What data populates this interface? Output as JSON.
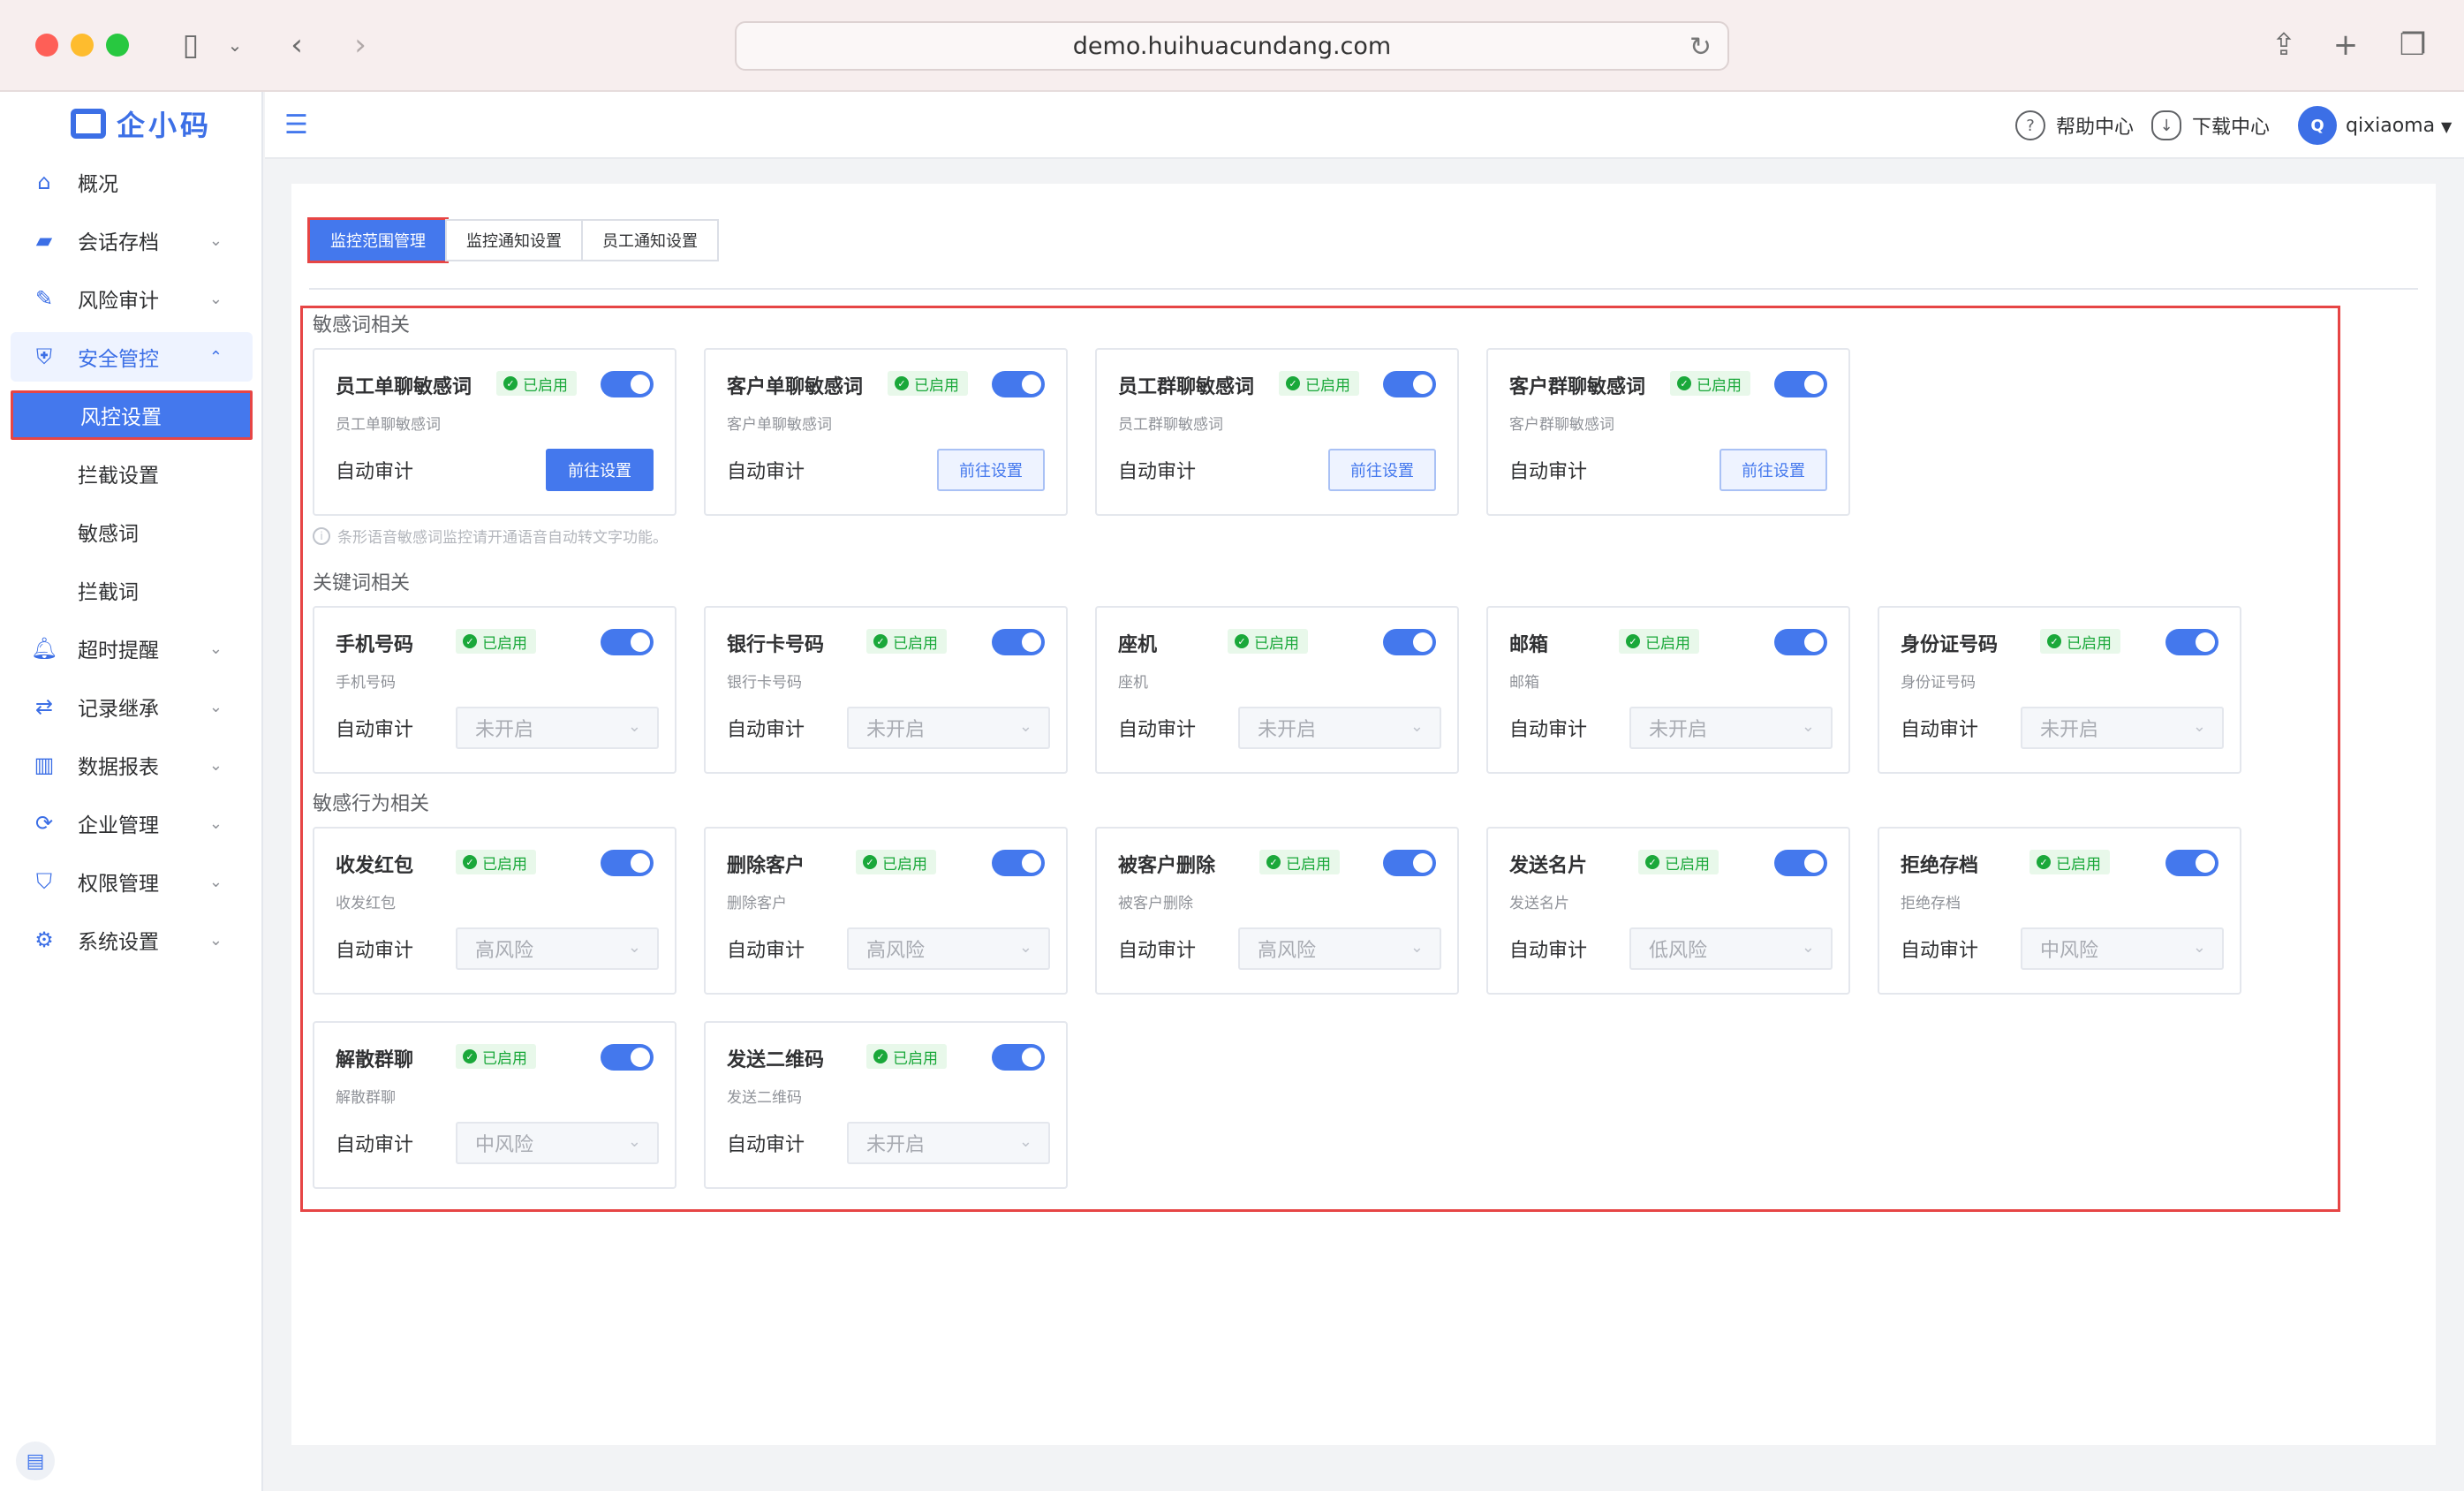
{
  "browser": {
    "url": "demo.huihuacundang.com"
  },
  "sidebar": {
    "logo": "企小码",
    "items": [
      {
        "label": "概况",
        "icon": "home-icon"
      },
      {
        "label": "会话存档",
        "icon": "folder-icon"
      },
      {
        "label": "风险审计",
        "icon": "edit-icon"
      },
      {
        "label": "安全管控",
        "icon": "shield-icon"
      },
      {
        "label": "超时提醒",
        "icon": "bell-icon"
      },
      {
        "label": "记录继承",
        "icon": "transfer-icon"
      },
      {
        "label": "数据报表",
        "icon": "chart-icon"
      },
      {
        "label": "企业管理",
        "icon": "sync-icon"
      },
      {
        "label": "权限管理",
        "icon": "lock-shield-icon"
      },
      {
        "label": "系统设置",
        "icon": "gear-icon"
      }
    ],
    "subitems": [
      "风控设置",
      "拦截设置",
      "敏感词",
      "拦截词"
    ]
  },
  "header": {
    "help": "帮助中心",
    "download": "下载中心",
    "avatar_letter": "Q",
    "username": "qixiaoma"
  },
  "tabs": [
    "监控范围管理",
    "监控通知设置",
    "员工通知设置"
  ],
  "sections": {
    "sensitive": "敏感词相关",
    "keyword": "关键词相关",
    "behavior": "敏感行为相关"
  },
  "hint": "条形语音敏感词监控请开通语音自动转文字功能。",
  "common": {
    "enabled": "已启用",
    "auto_audit": "自动审计",
    "goto": "前往设置"
  },
  "sensitive_cards": [
    {
      "title": "员工单聊敏感词",
      "sub": "员工单聊敏感词"
    },
    {
      "title": "客户单聊敏感词",
      "sub": "客户单聊敏感词"
    },
    {
      "title": "员工群聊敏感词",
      "sub": "员工群聊敏感词"
    },
    {
      "title": "客户群聊敏感词",
      "sub": "客户群聊敏感词"
    }
  ],
  "keyword_cards": [
    {
      "title": "手机号码",
      "sub": "手机号码",
      "select": "未开启"
    },
    {
      "title": "银行卡号码",
      "sub": "银行卡号码",
      "select": "未开启"
    },
    {
      "title": "座机",
      "sub": "座机",
      "select": "未开启"
    },
    {
      "title": "邮箱",
      "sub": "邮箱",
      "select": "未开启"
    },
    {
      "title": "身份证号码",
      "sub": "身份证号码",
      "select": "未开启"
    }
  ],
  "behavior_cards": [
    {
      "title": "收发红包",
      "sub": "收发红包",
      "select": "高风险"
    },
    {
      "title": "删除客户",
      "sub": "删除客户",
      "select": "高风险"
    },
    {
      "title": "被客户删除",
      "sub": "被客户删除",
      "select": "高风险"
    },
    {
      "title": "发送名片",
      "sub": "发送名片",
      "select": "低风险"
    },
    {
      "title": "拒绝存档",
      "sub": "拒绝存档",
      "select": "中风险"
    },
    {
      "title": "解散群聊",
      "sub": "解散群聊",
      "select": "中风险"
    },
    {
      "title": "发送二维码",
      "sub": "发送二维码",
      "select": "未开启"
    }
  ]
}
